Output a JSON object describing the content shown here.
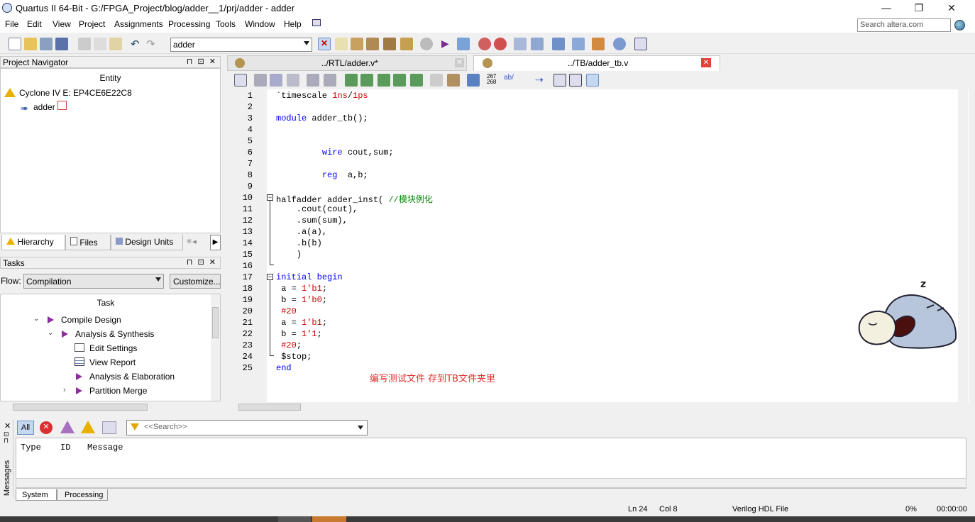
{
  "window": {
    "title": "Quartus II 64-Bit - G:/FPGA_Project/blog/adder__1/prj/adder - adder",
    "minimize": "—",
    "maximize": "❐",
    "close": "✕"
  },
  "menu": [
    "File",
    "Edit",
    "View",
    "Project",
    "Assignments",
    "Processing",
    "Tools",
    "Window",
    "Help"
  ],
  "search": {
    "placeholder": "Search altera.com"
  },
  "toolbar": {
    "entity": "adder"
  },
  "navigator": {
    "title": "Project Navigator",
    "column": "Entity",
    "device": "Cyclone IV E: EP4CE6E22C8",
    "top_entity": "adder",
    "tabs": [
      "Hierarchy",
      "Files",
      "Design Units"
    ]
  },
  "tasks": {
    "title": "Tasks",
    "flow_label": "Flow:",
    "flow_value": "Compilation",
    "customize": "Customize...",
    "column": "Task",
    "items": [
      "Compile Design",
      "Analysis & Synthesis",
      "Edit Settings",
      "View Report",
      "Analysis & Elaboration",
      "Partition Merge"
    ]
  },
  "editor": {
    "tabs": [
      "../RTL/adder.v*",
      "../TB/adder_tb.v"
    ],
    "line_numbers": [
      "1",
      "2",
      "3",
      "4",
      "5",
      "6",
      "7",
      "8",
      "9",
      "10",
      "11",
      "12",
      "13",
      "14",
      "15",
      "16",
      "17",
      "18",
      "19",
      "20",
      "21",
      "22",
      "23",
      "24",
      "25"
    ],
    "annotation": "编写测试文件 存到TB文件夹里"
  },
  "messages": {
    "side_label": "Messages",
    "filter_all": "All",
    "search_placeholder": "<<Search>>",
    "columns": [
      "Type",
      "ID",
      "Message"
    ],
    "tabs": [
      "System",
      "Processing"
    ]
  },
  "status": {
    "line": "Ln 24",
    "col": "Col 8",
    "filetype": "Verilog HDL File",
    "progress": "0%",
    "time": "00:00:00"
  }
}
